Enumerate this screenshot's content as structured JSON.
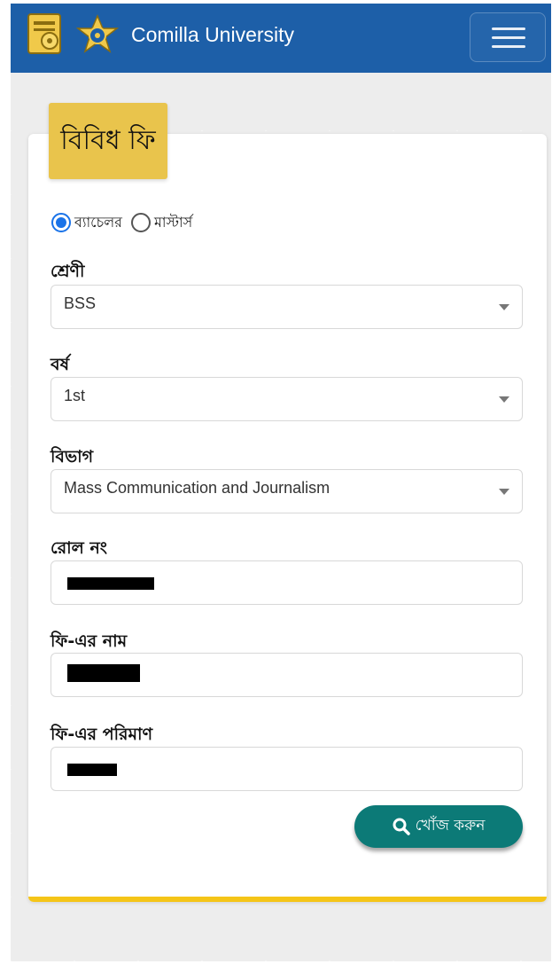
{
  "header": {
    "brand": "Comilla University",
    "logo_icon": "university-logo-icon",
    "menu_icon": "hamburger-menu-icon",
    "bg_color": "#1d5fa8"
  },
  "form": {
    "title": "বিবিধ ফি",
    "degree_options": [
      {
        "label": "ব্যাচেলর",
        "checked": true
      },
      {
        "label": "মাস্টার্স",
        "checked": false
      }
    ],
    "class_label": "শ্রেণী",
    "class_value": "BSS",
    "year_label": "বর্ষ",
    "year_value": "1st",
    "department_label": "বিভাগ",
    "department_value": "Mass Communication and Journalism",
    "roll_label": "রোল নং",
    "fee_name_label": "ফি-এর নাম",
    "fee_amount_label": "ফি-এর পরিমাণ",
    "search_button": "খোঁজ করুন",
    "search_icon": "search-icon",
    "accent_color": "#f5c518",
    "button_color": "#0c7a77"
  }
}
